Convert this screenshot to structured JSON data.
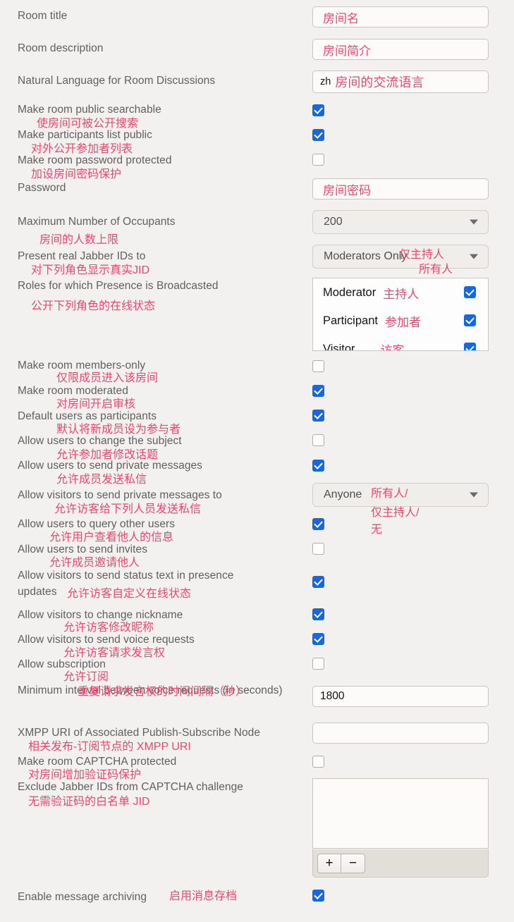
{
  "colors": {
    "background": "#f2f1ef",
    "label": "#5f5f5f",
    "annotation": "#f0466e",
    "checkbox_checked": "#1668dc",
    "field_border": "#c8c5c0",
    "field_bg": "#fcfbfa",
    "select_bg": "#f0eeea"
  },
  "form": {
    "fields": [
      {
        "id": "room-title",
        "label": "Room title",
        "annotation": "",
        "control": "text",
        "value": "房间名"
      },
      {
        "id": "room-description",
        "label": "Room description",
        "annotation": "",
        "control": "text",
        "value": "房间简介"
      },
      {
        "id": "room-language",
        "label": "Natural Language for Room Discussions",
        "annotation": "",
        "control": "language",
        "value_code": "zh",
        "value_zh": "房间的交流语言"
      },
      {
        "id": "public-searchable",
        "label": "Make room public searchable",
        "annotation": "使房间可被公开搜索",
        "control": "checkbox",
        "checked": true
      },
      {
        "id": "participants-list-public",
        "label": "Make participants list public",
        "annotation": "对外公开参加者列表",
        "control": "checkbox",
        "checked": true
      },
      {
        "id": "password-protected",
        "label": "Make room password protected",
        "annotation": "加设房间密码保护",
        "control": "checkbox",
        "checked": false
      },
      {
        "id": "password",
        "label": "Password",
        "annotation": "",
        "control": "text",
        "value": "房间密码"
      },
      {
        "id": "max-occupants",
        "label": "Maximum Number of Occupants",
        "annotation": "房间的人数上限",
        "control": "select",
        "value": "200"
      },
      {
        "id": "present-real-jids",
        "label": "Present real Jabber IDs to",
        "annotation": "对下列角色显示真实JID",
        "control": "select",
        "value": "Moderators Only",
        "value_annotation_1": "仅主持人",
        "value_annotation_2": "所有人"
      },
      {
        "id": "presence-broadcast-roles",
        "label": "Roles for which Presence is Broadcasted",
        "annotation": "公开下列角色的在线状态",
        "control": "listbox",
        "items": [
          {
            "en": "Moderator",
            "zh": "主持人",
            "checked": true
          },
          {
            "en": "Participant",
            "zh": "参加者",
            "checked": true
          },
          {
            "en": "Visitor",
            "zh": "访客",
            "checked": true
          }
        ]
      },
      {
        "id": "members-only",
        "label": "Make room members-only",
        "annotation": "仅限成员进入该房间",
        "control": "checkbox",
        "checked": false
      },
      {
        "id": "moderated",
        "label": "Make room moderated",
        "annotation": "对房间开启审核",
        "control": "checkbox",
        "checked": true
      },
      {
        "id": "default-participants",
        "label": "Default users as participants",
        "annotation": "默认将新成员设为参与者",
        "control": "checkbox",
        "checked": true
      },
      {
        "id": "change-subject",
        "label": "Allow users to change the subject",
        "annotation": "允许参加者修改话题",
        "control": "checkbox",
        "checked": false
      },
      {
        "id": "send-private-messages",
        "label": "Allow users to send private messages",
        "annotation": "允许成员发送私信",
        "control": "checkbox",
        "checked": true
      },
      {
        "id": "visitor-private-messages-to",
        "label": "Allow visitors to send private messages to",
        "annotation": "允许访客给下列人员发送私信",
        "control": "select",
        "value": "Anyone",
        "value_annotation_1": "所有人/",
        "value_annotation_2": "仅主持人/",
        "value_annotation_3": "无"
      },
      {
        "id": "query-other-users",
        "label": "Allow users to query other users",
        "annotation": "允许用户查看他人的信息",
        "control": "checkbox",
        "checked": true
      },
      {
        "id": "send-invites",
        "label": "Allow users to send invites",
        "annotation": "允许成员邀请他人",
        "control": "checkbox",
        "checked": false
      },
      {
        "id": "visitor-status-text",
        "label": "Allow visitors to send status text in presence updates",
        "annotation": "允许访客自定义在线状态",
        "control": "checkbox",
        "checked": true
      },
      {
        "id": "visitor-change-nickname",
        "label": "Allow visitors to change nickname",
        "annotation": "允许访客修改昵称",
        "control": "checkbox",
        "checked": true
      },
      {
        "id": "visitor-voice-requests",
        "label": "Allow visitors to send voice requests",
        "annotation": "允许访客请求发言权",
        "control": "checkbox",
        "checked": true
      },
      {
        "id": "allow-subscription",
        "label": "Allow subscription",
        "annotation": "允许订阅",
        "control": "checkbox",
        "checked": false
      },
      {
        "id": "voice-request-interval",
        "label": "Minimum interval between voice requests (in seconds)",
        "annotation": "重复请求发言权的时间间隔（秒）",
        "control": "text",
        "value": "1800"
      },
      {
        "id": "pubsub-uri",
        "label": "XMPP URI of Associated Publish-Subscribe Node",
        "annotation": "相关发布-订阅节点的 XMPP URI",
        "control": "text",
        "value": ""
      },
      {
        "id": "captcha-protected",
        "label": "Make room CAPTCHA protected",
        "annotation": "对房间增加验证码保护",
        "control": "checkbox",
        "checked": false
      },
      {
        "id": "captcha-whitelist",
        "label": "Exclude Jabber IDs from CAPTCHA challenge",
        "annotation": "无需验证码的白名单 JID",
        "control": "jidlist",
        "items": [],
        "add_label": "+",
        "remove_label": "−"
      },
      {
        "id": "message-archiving",
        "label": "Enable message archiving",
        "annotation": "启用消息存档",
        "control": "checkbox",
        "checked": true
      }
    ]
  }
}
